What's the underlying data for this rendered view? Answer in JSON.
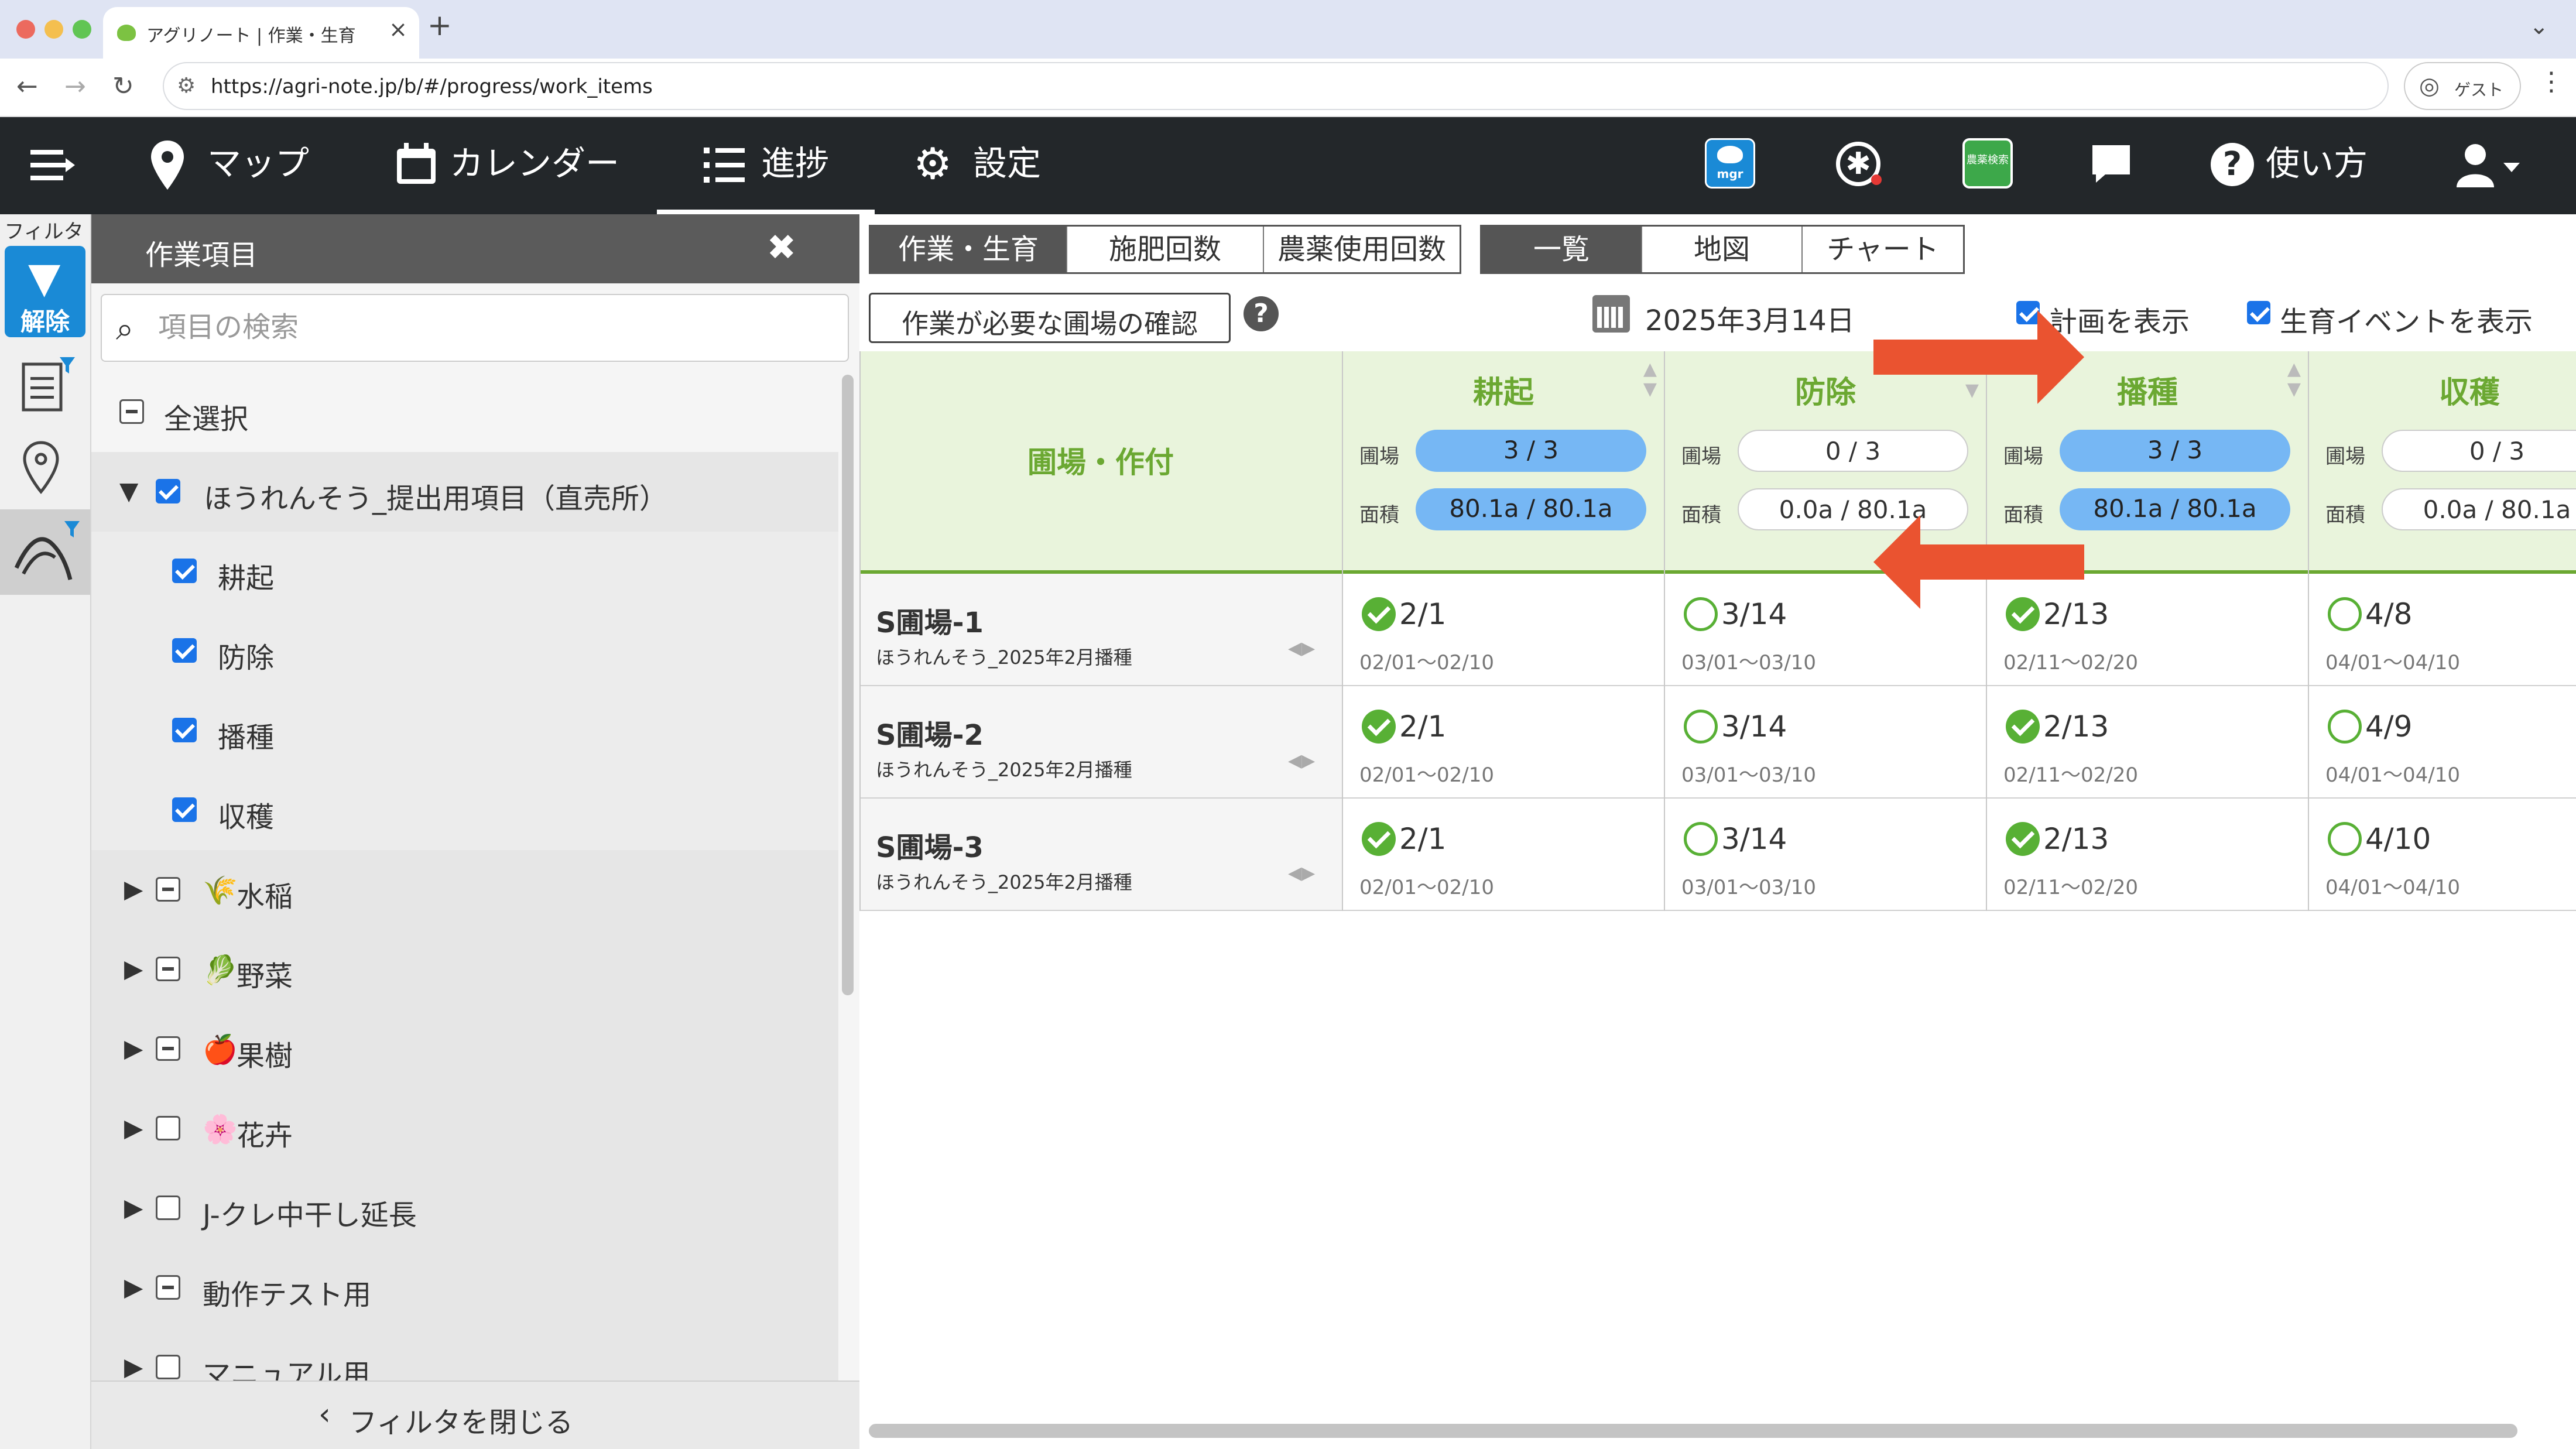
{
  "browser": {
    "tab_title": "アグリノート | 作業・生育",
    "url": "https://agri-note.jp/b/#/progress/work_items",
    "guest_label": "ゲスト"
  },
  "nav": {
    "items": [
      {
        "label": "マップ",
        "icon": "map-pin-icon"
      },
      {
        "label": "カレンダー",
        "icon": "calendar-icon"
      },
      {
        "label": "進捗",
        "icon": "list-icon",
        "active": true
      },
      {
        "label": "設定",
        "icon": "gear-icon"
      }
    ],
    "help_label": "使い方",
    "mgr_icon_text": "mgr",
    "green_icon_text": "農薬検索"
  },
  "rail": {
    "label": "フィルタ",
    "filter_button": "解除"
  },
  "filter": {
    "title": "作業項目",
    "search_placeholder": "項目の検索",
    "select_all": "全選択",
    "groups": [
      {
        "label": "ほうれんそう_提出用項目（直売所）",
        "expanded": true,
        "check": "on",
        "children": [
          {
            "label": "耕起",
            "check": "on"
          },
          {
            "label": "防除",
            "check": "on"
          },
          {
            "label": "播種",
            "check": "on"
          },
          {
            "label": "収穫",
            "check": "on"
          }
        ]
      },
      {
        "label": "水稲",
        "emoji": "🌾",
        "check": "ind"
      },
      {
        "label": "野菜",
        "emoji": "🥬",
        "check": "ind"
      },
      {
        "label": "果樹",
        "emoji": "🍎",
        "check": "ind"
      },
      {
        "label": "花卉",
        "emoji": "🌸",
        "check": "off"
      },
      {
        "label": "J-クレ中干し延長",
        "check": "off"
      },
      {
        "label": "動作テスト用",
        "check": "ind"
      },
      {
        "label": "マニュアル用",
        "check": "off"
      }
    ],
    "close_label": "フィルタを閉じる"
  },
  "main": {
    "seg1": [
      "作業・生育",
      "施肥回数",
      "農薬使用回数"
    ],
    "seg2": [
      "一覧",
      "地図",
      "チャート"
    ],
    "check_button": "作業が必要な圃場の確認",
    "date": "2025年3月14日",
    "show_plan": "計画を表示",
    "show_events": "生育イベントを表示"
  },
  "table": {
    "field_header": "圃場・作付",
    "field_label": "圃場",
    "area_label": "面積",
    "columns": [
      {
        "name": "耕起",
        "fields": "3 / 3",
        "area": "80.1a / 80.1a",
        "full": true
      },
      {
        "name": "防除",
        "fields": "0 / 3",
        "area": "0.0a / 80.1a",
        "full": false
      },
      {
        "name": "播種",
        "fields": "3 / 3",
        "area": "80.1a / 80.1a",
        "full": true
      },
      {
        "name": "収穫",
        "fields": "0 / 3",
        "area": "0.0a / 80.1a",
        "full": false
      }
    ],
    "rows": [
      {
        "field": "S圃場-1",
        "crop": "ほうれんそう_2025年2月播種",
        "cells": [
          {
            "status": "done",
            "date": "2/1",
            "range": "02/01〜02/10"
          },
          {
            "status": "todo",
            "date": "3/14",
            "range": "03/01〜03/10"
          },
          {
            "status": "done",
            "date": "2/13",
            "range": "02/11〜02/20"
          },
          {
            "status": "todo",
            "date": "4/8",
            "range": "04/01〜04/10"
          }
        ]
      },
      {
        "field": "S圃場-2",
        "crop": "ほうれんそう_2025年2月播種",
        "cells": [
          {
            "status": "done",
            "date": "2/1",
            "range": "02/01〜02/10"
          },
          {
            "status": "todo",
            "date": "3/14",
            "range": "03/01〜03/10"
          },
          {
            "status": "done",
            "date": "2/13",
            "range": "02/11〜02/20"
          },
          {
            "status": "todo",
            "date": "4/9",
            "range": "04/01〜04/10"
          }
        ]
      },
      {
        "field": "S圃場-3",
        "crop": "ほうれんそう_2025年2月播種",
        "cells": [
          {
            "status": "done",
            "date": "2/1",
            "range": "02/01〜02/10"
          },
          {
            "status": "todo",
            "date": "3/14",
            "range": "03/01〜03/10"
          },
          {
            "status": "done",
            "date": "2/13",
            "range": "02/11〜02/20"
          },
          {
            "status": "todo",
            "date": "4/10",
            "range": "04/01〜04/10"
          }
        ]
      }
    ]
  },
  "colors": {
    "accent_green": "#6ba832",
    "header_bg": "#e9f4dc",
    "pill_blue": "#76b7f4",
    "nav_dark": "#23272a",
    "annotation_arrow": "#ea5330"
  }
}
